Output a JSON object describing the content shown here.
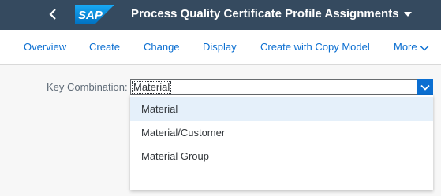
{
  "shell": {
    "logo_text": "SAP",
    "app_title": "Process Quality Certificate Profile Assignments",
    "back_icon": "chevron-left-icon",
    "title_icon": "caret-down-icon"
  },
  "toolbar": {
    "items": [
      "Overview",
      "Create",
      "Change",
      "Display",
      "Create with Copy Model"
    ],
    "more_label": "More",
    "more_icon": "chevron-down-icon"
  },
  "form": {
    "key_combination_label": "Key Combination:",
    "key_combination_value": "Material",
    "arrow_icon": "chevron-down-icon"
  },
  "dropdown": {
    "options": [
      "Material",
      "Material/Customer",
      "Material Group"
    ],
    "selected_index": 0
  },
  "colors": {
    "shell_bg": "#354a5f",
    "link": "#0a6ed1",
    "selected_bg": "#e5f0fa"
  }
}
